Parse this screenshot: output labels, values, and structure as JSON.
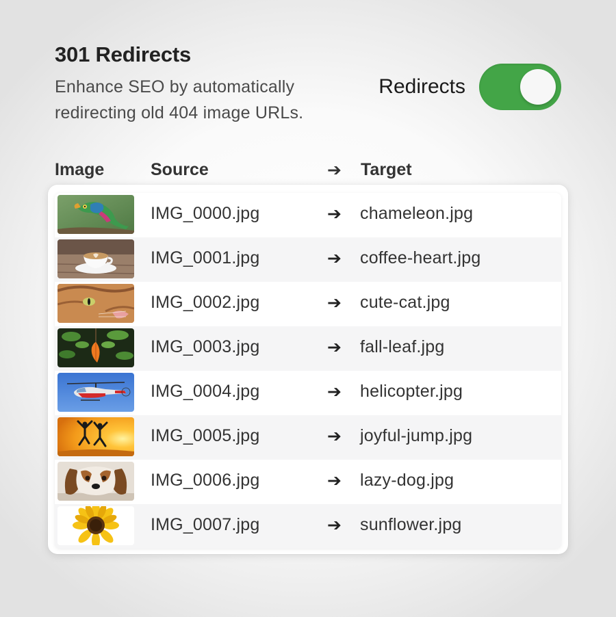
{
  "header": {
    "title": "301 Redirects",
    "description": "Enhance SEO by automatically redirecting old 404 image URLs."
  },
  "toggle": {
    "label": "Redirects",
    "state": "on",
    "on_color": "#43a547"
  },
  "columns": {
    "image": "Image",
    "source": "Source",
    "arrow": "➔",
    "target": "Target"
  },
  "rows": [
    {
      "thumb": "chameleon-photo",
      "source": "IMG_0000.jpg",
      "arrow": "➔",
      "target": "chameleon.jpg"
    },
    {
      "thumb": "coffee-heart-photo",
      "source": "IMG_0001.jpg",
      "arrow": "➔",
      "target": "coffee-heart.jpg"
    },
    {
      "thumb": "cute-cat-photo",
      "source": "IMG_0002.jpg",
      "arrow": "➔",
      "target": "cute-cat.jpg"
    },
    {
      "thumb": "fall-leaf-photo",
      "source": "IMG_0003.jpg",
      "arrow": "➔",
      "target": "fall-leaf.jpg"
    },
    {
      "thumb": "helicopter-photo",
      "source": "IMG_0004.jpg",
      "arrow": "➔",
      "target": "helicopter.jpg"
    },
    {
      "thumb": "joyful-jump-photo",
      "source": "IMG_0005.jpg",
      "arrow": "➔",
      "target": "joyful-jump.jpg"
    },
    {
      "thumb": "lazy-dog-photo",
      "source": "IMG_0006.jpg",
      "arrow": "➔",
      "target": "lazy-dog.jpg"
    },
    {
      "thumb": "sunflower-photo",
      "source": "IMG_0007.jpg",
      "arrow": "➔",
      "target": "sunflower.jpg"
    }
  ]
}
